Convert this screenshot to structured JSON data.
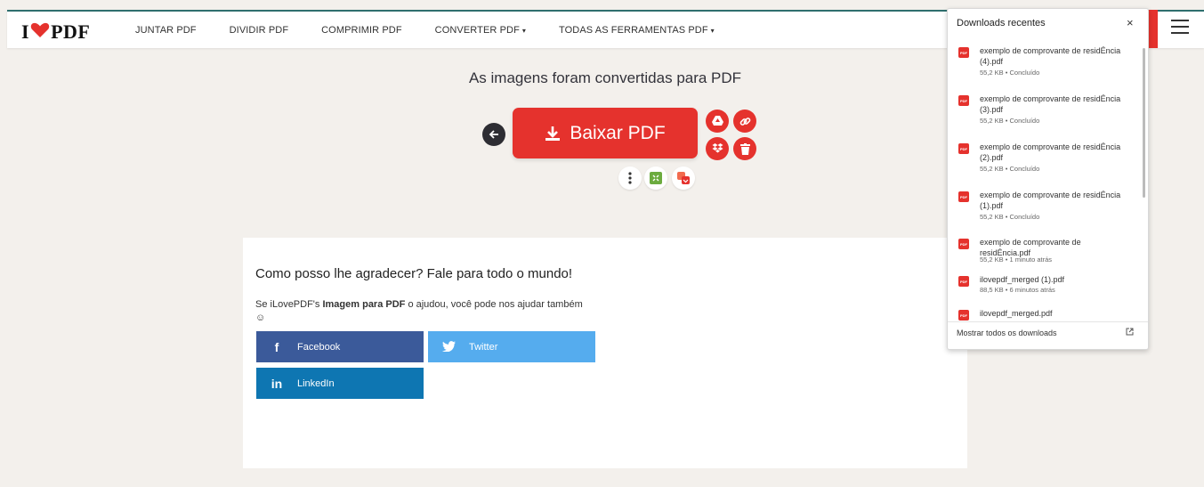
{
  "header": {
    "logo_left": "I",
    "logo_right": "PDF",
    "nav": [
      {
        "label": "JUNTAR PDF"
      },
      {
        "label": "DIVIDIR PDF"
      },
      {
        "label": "COMPRIMIR PDF"
      },
      {
        "label": "CONVERTER PDF",
        "dropdown": true
      },
      {
        "label": "TODAS AS FERRAMENTAS PDF",
        "dropdown": true
      }
    ],
    "caret": "▾"
  },
  "main": {
    "title": "As imagens foram convertidas para PDF",
    "download_label": "Baixar PDF"
  },
  "share": {
    "heading": "Como posso lhe agradecer? Fale para todo o mundo!",
    "text_before": "Se iLovePDF's ",
    "text_bold": "Imagem para PDF",
    "text_after": " o ajudou, você pode nos ajudar também",
    "emoji": "☺",
    "facebook": "Facebook",
    "twitter": "Twitter",
    "linkedin": "LinkedIn"
  },
  "downloads": {
    "title": "Downloads recentes",
    "close": "×",
    "items": [
      {
        "name": "exemplo de comprovante de residÉncia (4).pdf",
        "meta": "55,2 KB • Concluído"
      },
      {
        "name": "exemplo de comprovante de residÉncia (3).pdf",
        "meta": "55,2 KB • Concluído"
      },
      {
        "name": "exemplo de comprovante de residÉncia (2).pdf",
        "meta": "55,2 KB • Concluído"
      },
      {
        "name": "exemplo de comprovante de residÉncia (1).pdf",
        "meta": "55,2 KB • Concluído"
      },
      {
        "name": "exemplo de comprovante de residÉncia.pdf",
        "meta": "55,2 KB • 1 minuto atrás"
      },
      {
        "name": "ilovepdf_merged (1).pdf",
        "meta": "88,5 KB • 6 minutos atrás"
      },
      {
        "name": "ilovepdf_merged.pdf",
        "meta": ""
      }
    ],
    "show_all": "Mostrar todos os downloads",
    "file_icon_text": "PDF"
  },
  "colors": {
    "brand_red": "#e5322d",
    "facebook": "#3b5a9a",
    "twitter": "#55acee",
    "linkedin": "#0e76b2"
  }
}
